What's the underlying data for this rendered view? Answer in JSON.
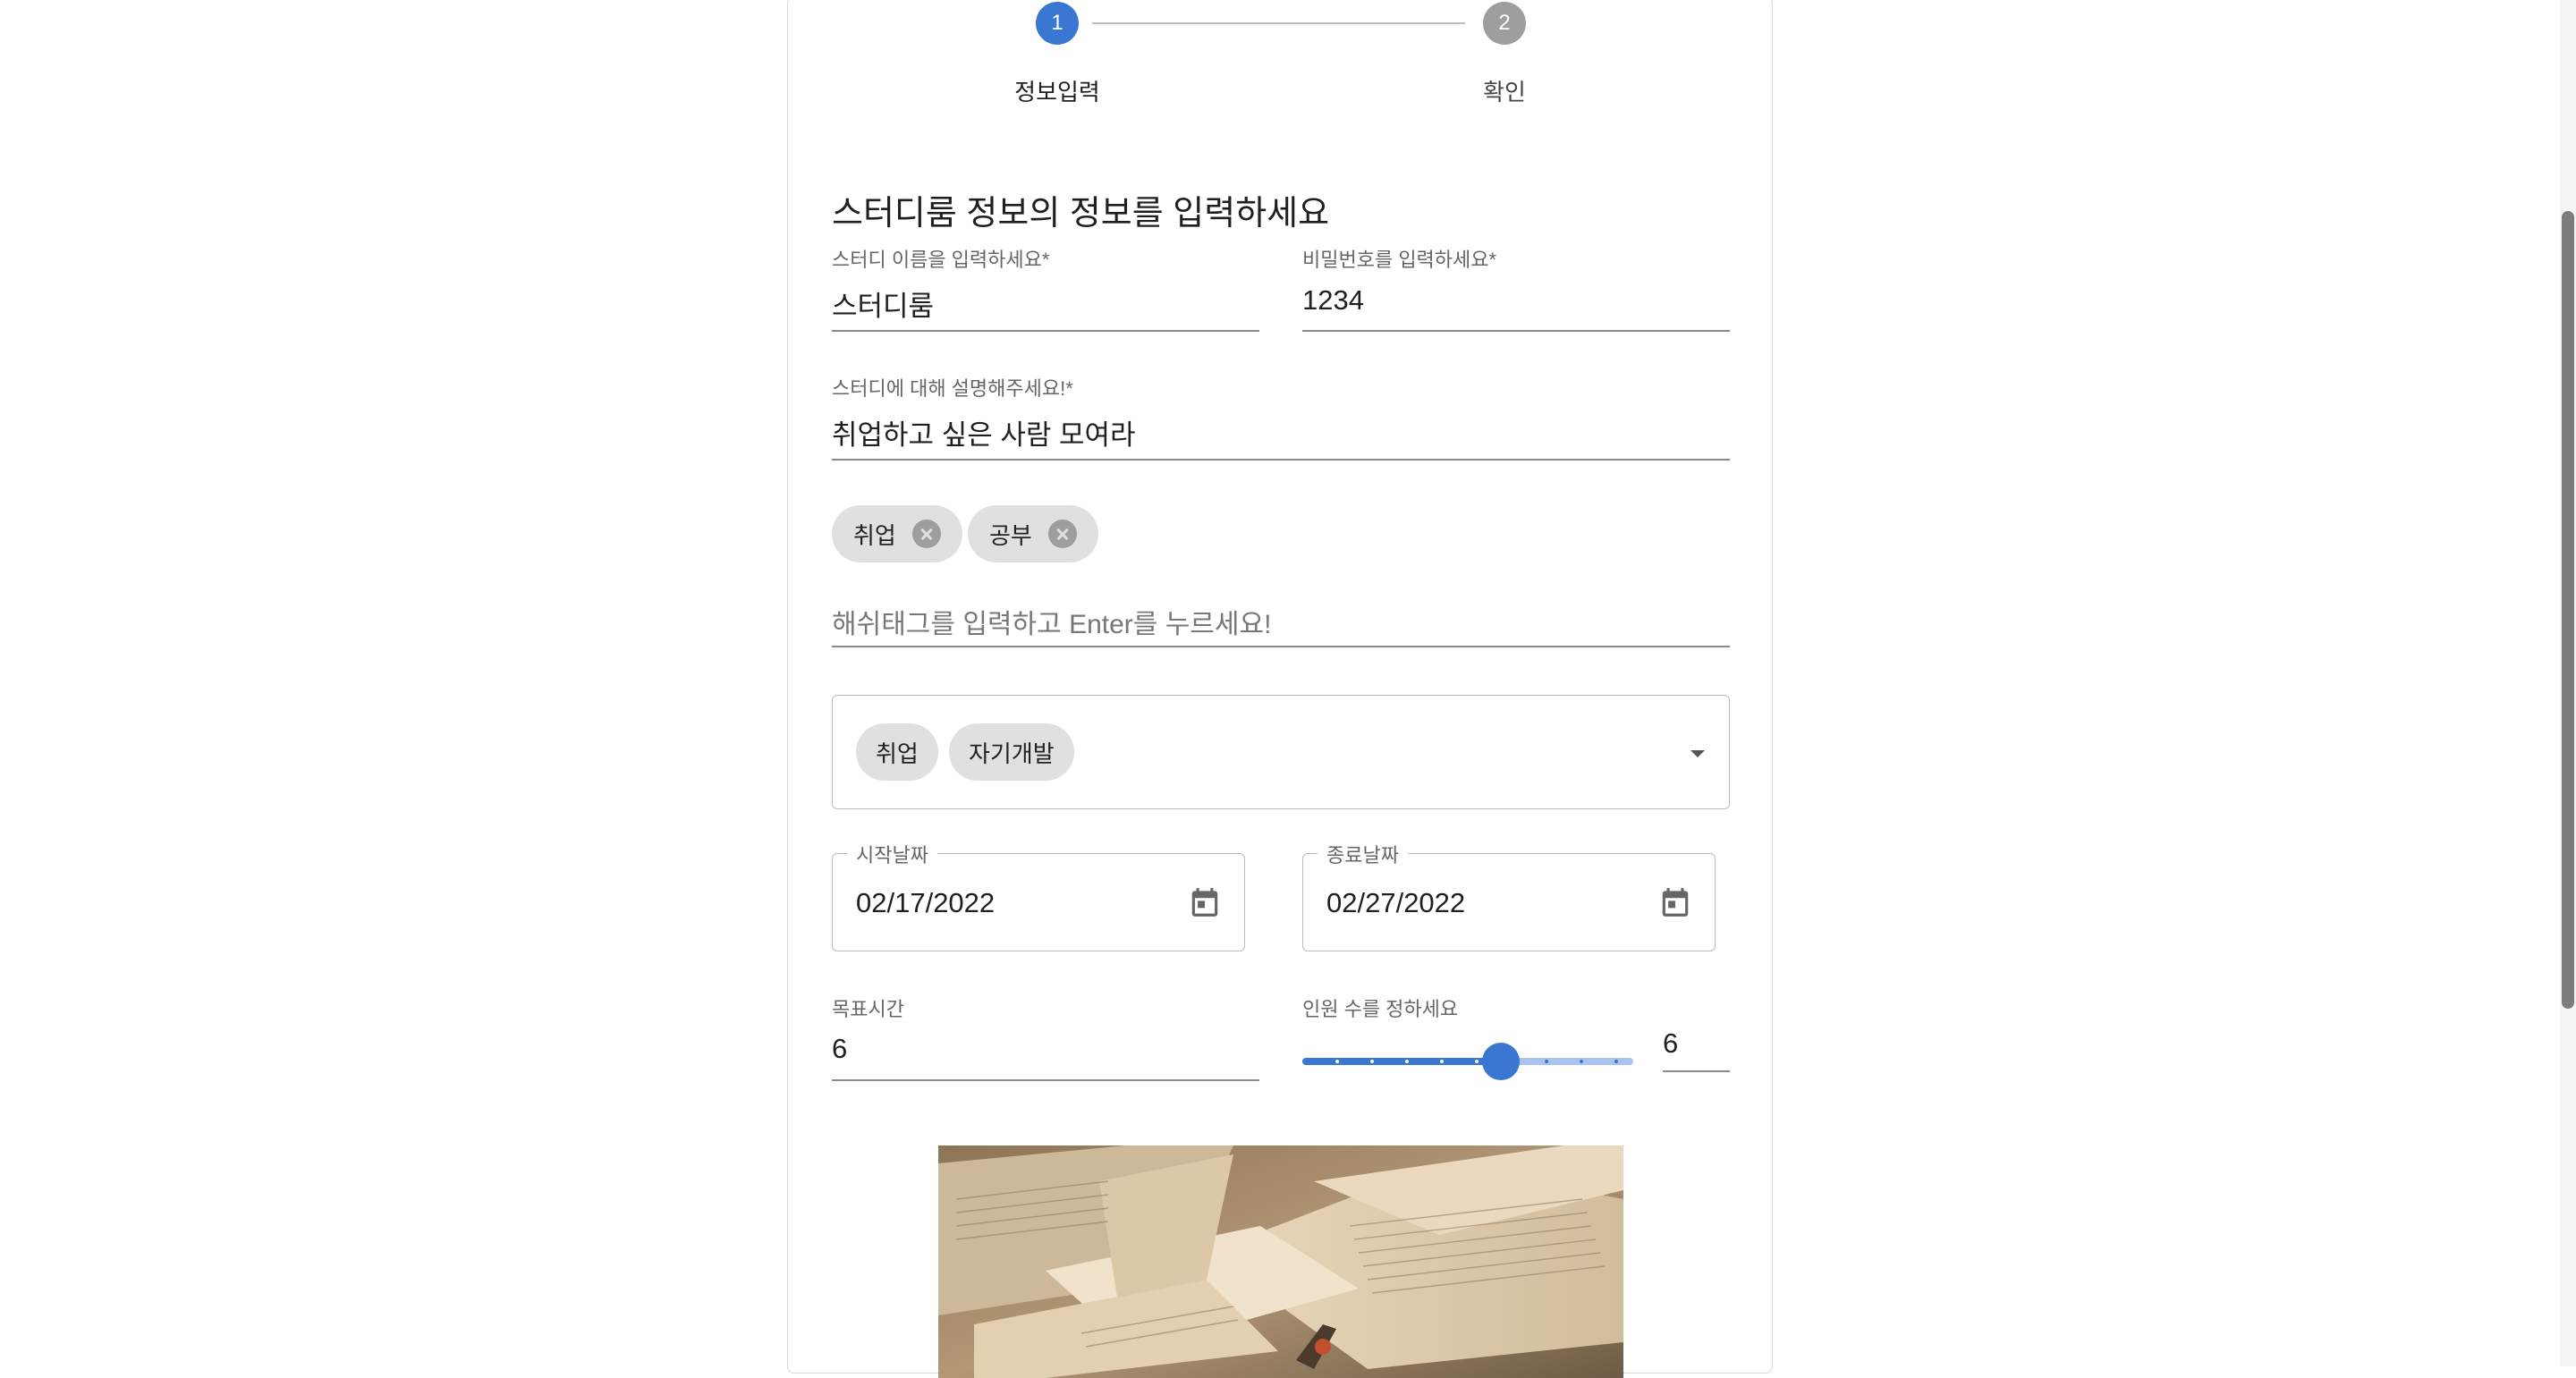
{
  "stepper": {
    "steps": [
      {
        "number": "1",
        "label": "정보입력",
        "active": true
      },
      {
        "number": "2",
        "label": "확인",
        "active": false
      }
    ]
  },
  "form": {
    "title": "스터디룸 정보의 정보를 입력하세요",
    "study_name": {
      "label": "스터디 이름을 입력하세요",
      "required_mark": "*",
      "value": "스터디룸"
    },
    "password": {
      "label": "비밀번호를 입력하세요",
      "required_mark": "*",
      "value": "1234"
    },
    "description": {
      "label": "스터디에 대해 설명해주세요!",
      "required_mark": "*",
      "value": "취업하고 싶은 사람 모여라"
    },
    "hashtags": [
      "취업",
      "공부"
    ],
    "hashtag_input": {
      "placeholder": "해쉬태그를 입력하고 Enter를 누르세요!",
      "value": ""
    },
    "category_select": {
      "selected": [
        "취업",
        "자기개발"
      ]
    },
    "start_date": {
      "label": "시작날짜",
      "value": "02/17/2022"
    },
    "end_date": {
      "label": "종료날짜",
      "value": "02/27/2022"
    },
    "goal_time": {
      "label": "목표시간",
      "value": "6"
    },
    "member_count": {
      "label": "인원 수를 정하세요",
      "value": "6",
      "slider_fraction": 0.6
    }
  },
  "colors": {
    "primary": "#3a77d3",
    "step_inactive": "#9e9e9e",
    "chip_bg": "#e0e0e0"
  },
  "icons": {
    "calendar": "calendar-icon",
    "dropdown": "arrow-drop-down-icon",
    "chip_delete": "cancel-icon"
  },
  "image": {
    "description_visible": false
  }
}
